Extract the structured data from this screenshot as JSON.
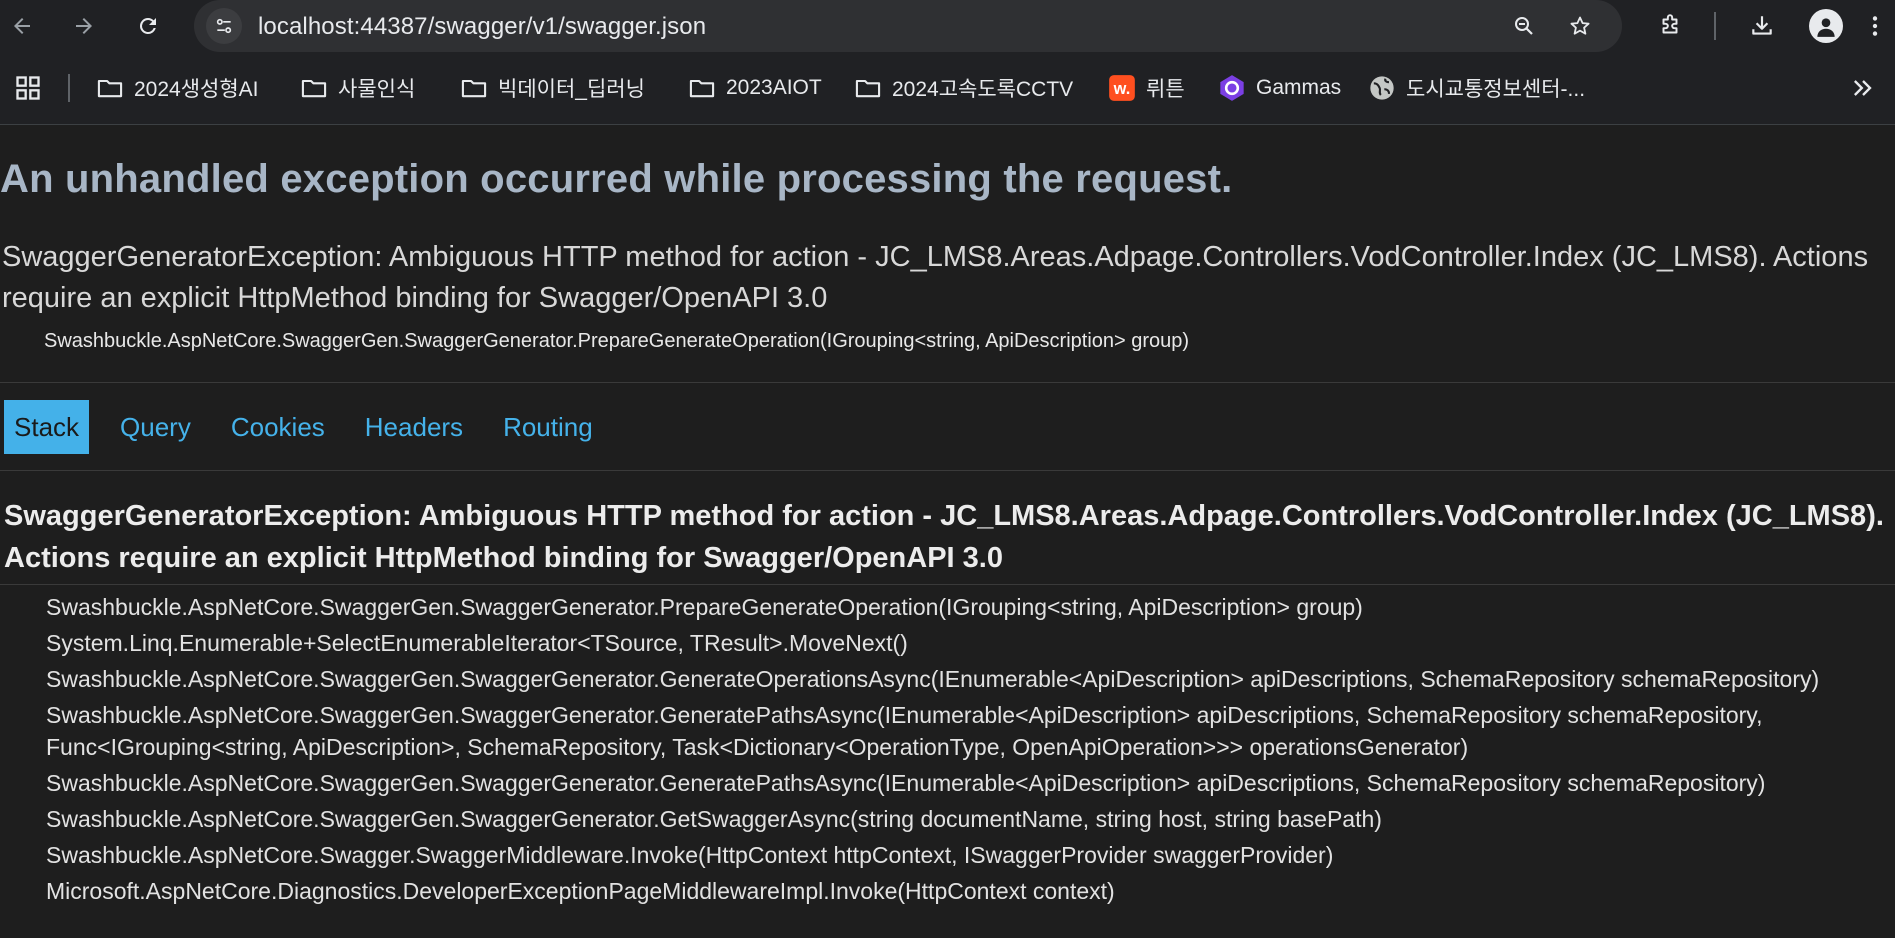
{
  "browser": {
    "url": "localhost:44387/swagger/v1/swagger.json",
    "bookmarks": [
      {
        "label": "2024생성형AI",
        "icon": "folder-icon"
      },
      {
        "label": "사물인식",
        "icon": "folder-icon"
      },
      {
        "label": "빅데이터_딥러닝",
        "icon": "folder-icon"
      },
      {
        "label": "2023AIOT",
        "icon": "folder-icon"
      },
      {
        "label": "2024고속도록CCTV",
        "icon": "folder-icon"
      },
      {
        "label": "뤼튼",
        "icon": "wrtn-logo-icon"
      },
      {
        "label": "Gammas",
        "icon": "gamma-logo-icon"
      },
      {
        "label": "도시교통정보센터-...",
        "icon": "globe-icon"
      }
    ]
  },
  "error": {
    "heading": "An unhandled exception occurred while processing the request.",
    "title": "SwaggerGeneratorException: Ambiguous HTTP method for action - JC_LMS8.Areas.Adpage.Controllers.VodController.Index (JC_LMS8). Actions require an explicit HttpMethod binding for Swagger/OpenAPI 3.0",
    "location": "Swashbuckle.AspNetCore.SwaggerGen.SwaggerGenerator.PrepareGenerateOperation(IGrouping<string, ApiDescription> group)",
    "tabs": [
      "Stack",
      "Query",
      "Cookies",
      "Headers",
      "Routing"
    ],
    "active_tab": "Stack",
    "exception_title": "SwaggerGeneratorException: Ambiguous HTTP method for action - JC_LMS8.Areas.Adpage.Controllers.VodController.Index (JC_LMS8). Actions require an explicit HttpMethod binding for Swagger/OpenAPI 3.0",
    "frames": [
      "Swashbuckle.AspNetCore.SwaggerGen.SwaggerGenerator.PrepareGenerateOperation(IGrouping<string, ApiDescription> group)",
      "System.Linq.Enumerable+SelectEnumerableIterator<TSource, TResult>.MoveNext()",
      "Swashbuckle.AspNetCore.SwaggerGen.SwaggerGenerator.GenerateOperationsAsync(IEnumerable<ApiDescription> apiDescriptions, SchemaRepository schemaRepository)",
      "Swashbuckle.AspNetCore.SwaggerGen.SwaggerGenerator.GeneratePathsAsync(IEnumerable<ApiDescription> apiDescriptions, SchemaRepository schemaRepository, Func<IGrouping<string, ApiDescription>, SchemaRepository, Task<Dictionary<OperationType, OpenApiOperation>>> operationsGenerator)",
      "Swashbuckle.AspNetCore.SwaggerGen.SwaggerGenerator.GeneratePathsAsync(IEnumerable<ApiDescription> apiDescriptions, SchemaRepository schemaRepository)",
      "Swashbuckle.AspNetCore.SwaggerGen.SwaggerGenerator.GetSwaggerAsync(string documentName, string host, string basePath)",
      "Swashbuckle.AspNetCore.Swagger.SwaggerMiddleware.Invoke(HttpContext httpContext, ISwaggerProvider swaggerProvider)",
      "Microsoft.AspNetCore.Diagnostics.DeveloperExceptionPageMiddlewareImpl.Invoke(HttpContext context)"
    ]
  },
  "colors": {
    "heading": "#a8b6c6",
    "tab_link": "#45b2ea",
    "tab_active_bg": "#44b1e9"
  }
}
